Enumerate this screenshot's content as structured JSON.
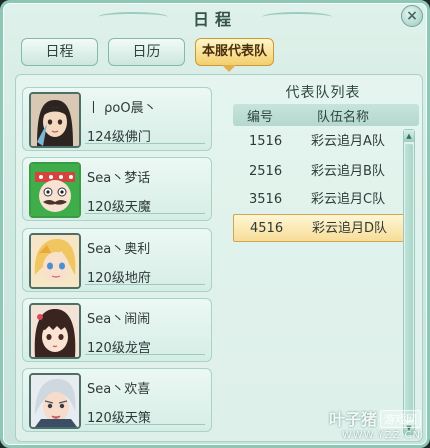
{
  "window": {
    "title": "日程",
    "close_glyph": "×"
  },
  "tabs": [
    {
      "label": "日程",
      "active": false
    },
    {
      "label": "日历",
      "active": false
    },
    {
      "label": "本服代表队",
      "active": true
    }
  ],
  "members": [
    {
      "name": "丨 ρoO晨丶",
      "level": "124级佛门",
      "avatar": "avatar-dark-hair"
    },
    {
      "name": "Sea丶梦话",
      "level": "120级天魔",
      "avatar": "avatar-mustache-mask"
    },
    {
      "name": "Sea丶奥利",
      "level": "120级地府",
      "avatar": "avatar-blonde"
    },
    {
      "name": "Sea丶闹闹",
      "level": "120级龙宫",
      "avatar": "avatar-bangs"
    },
    {
      "name": "Sea丶欢喜",
      "level": "120级天策",
      "avatar": "avatar-silver-hair"
    }
  ],
  "team_panel": {
    "title": "代表队列表",
    "columns": {
      "id": "编号",
      "name": "队伍名称"
    },
    "rows": [
      {
        "id": "1516",
        "name": "彩云追月A队",
        "selected": false
      },
      {
        "id": "2516",
        "name": "彩云追月B队",
        "selected": false
      },
      {
        "id": "3516",
        "name": "彩云追月C队",
        "selected": false
      },
      {
        "id": "4516",
        "name": "彩云追月D队",
        "selected": true
      }
    ]
  },
  "watermark": {
    "brand": "叶子猪",
    "tag": "游戏网",
    "url": "WWW.YZZ.CN"
  },
  "colors": {
    "accent_gold": "#f4cf6b",
    "panel_green": "#cfe9e1"
  }
}
